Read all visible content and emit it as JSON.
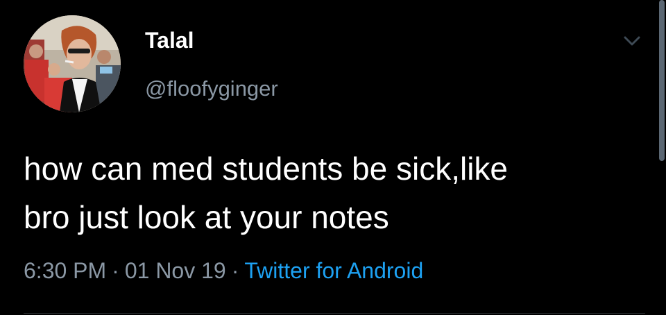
{
  "tweet": {
    "author": {
      "display_name": "Talal",
      "handle": "@floofyginger",
      "avatar": "profile-photo"
    },
    "text_lines": [
      "how can med students be sick,like",
      "bro just look at your notes"
    ],
    "meta": {
      "time": "6:30 PM",
      "separator": "·",
      "date": "01 Nov 19",
      "source": "Twitter for Android"
    },
    "menu_icon": "chevron-down-icon"
  },
  "colors": {
    "background": "#000000",
    "primary_text": "#ffffff",
    "secondary_text": "#8b98a5",
    "link": "#1da1f2"
  }
}
